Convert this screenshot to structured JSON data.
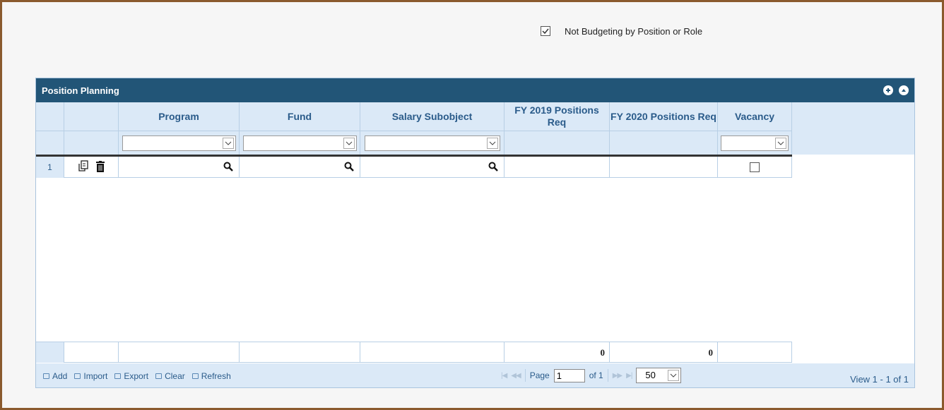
{
  "option": {
    "label": "Not Budgeting by Position or Role",
    "checked": true
  },
  "grid": {
    "title": "Position Planning",
    "columns": [
      {
        "label": ""
      },
      {
        "label": ""
      },
      {
        "label": "Program"
      },
      {
        "label": "Fund"
      },
      {
        "label": "Salary Subobject"
      },
      {
        "label": "FY 2019 Positions Req"
      },
      {
        "label": "FY 2020 Positions Req"
      },
      {
        "label": "Vacancy"
      }
    ],
    "rows": [
      {
        "num": "1",
        "vacancy_checked": false
      }
    ],
    "totals": {
      "fy2019": "0",
      "fy2020": "0"
    }
  },
  "pager": {
    "actions": [
      "Add",
      "Import",
      "Export",
      "Clear",
      "Refresh"
    ],
    "page_label": "Page",
    "page_value": "1",
    "of_label": "of 1",
    "page_size": "50",
    "view_text": "View 1 - 1 of 1"
  },
  "icons": [
    "plus-circle-icon",
    "collapse-icon",
    "copy-icon",
    "trash-icon",
    "search-icon",
    "chevron-down-icon"
  ]
}
